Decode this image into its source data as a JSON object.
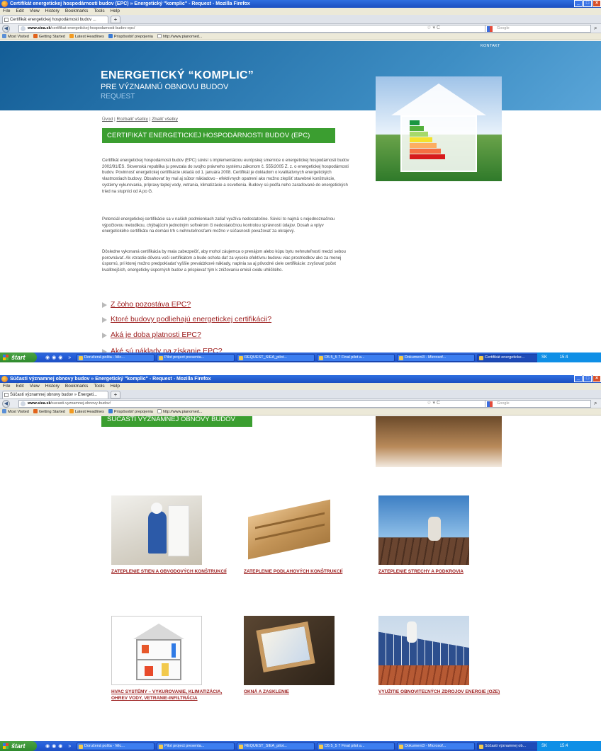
{
  "screen1": {
    "window_title": "Certifikát energetickej hospodárnosti budov (EPC) » Energetický \"komplic\" - Request - Mozilla Firefox",
    "menu": [
      "File",
      "Edit",
      "View",
      "History",
      "Bookmarks",
      "Tools",
      "Help"
    ],
    "tab_label": "Certifikát energetickej hospodárnosti budov ...",
    "url_domain": "www.siea.sk",
    "url_path": "/certifikat-energetickej-hospodarnosti-budov-epc/",
    "search_placeholder": "Google",
    "bookmarks": [
      "Most Visited",
      "Getting Started",
      "Latest Headlines",
      "Prispôsobiť prepojenia",
      "http://www.pianomed..."
    ],
    "page": {
      "kontakt": "KONTAKT",
      "brand_line1": "ENERGETICKÝ “KOMPLIC”",
      "brand_line2": "PRE VÝZNAMNÚ OBNOVU BUDOV",
      "brand_line3": "REQUEST",
      "crumb_uvod": "Úvod",
      "crumb_expand": "Rozbaliť všetky",
      "crumb_collapse": "Zbaliť všetky",
      "crumb_sep": " | ",
      "heading": "CERTIFIKÁT ENERGETICKEJ HOSPODÁRNOSTI BUDOV (EPC)",
      "paragraph1": "Certifikát energetickej hospodárnosti budov (EPC) súvisí s implementáciou európskej smernice o energetickej hospodárnosti budov 2002/91/ES. Slovenská republika ju prevzala do svojho právneho systému zákonom č. 555/2005 Z. z. o energetickej hospodárnosti budov. Povinnosť energetickej certifikácie ukladá od 1. januára 2008. Certifikát je dokladom o kvalitatívnych energetických vlastnostiach budovy. Obsahovať by mal aj súbor nákladovo - efektívnych opatrení ako možno zlepšiť stavebné konštrukcie, systémy vykurovania, prípravy teplej vody, vetrania, klimatizácie a osvetlenia. Budovy sú podľa neho zaraďované do energetických tried na stupnici od A po G.",
      "paragraph2": "Potenciál energetickej certifikácie sa v našich podmienkach zatiaľ využíva nedostatočne. Súvisí to najmä s nejednoznačnou výpočtovou metodikou, chýbajúcim jednotným softvérom či nedostatočnou kontrolou správnosti údajov. Dosah a vplyv energetického certifikátu na domáci trh s nehnuteľnosťami možno v súčasnosti považovať za okrajový.",
      "paragraph3": "Dôsledne vykonaná certifikácia by mala zabezpečiť, aby mohol záujemca o prenájom alebo kúpu bytu nehnuteľnosti medzi sebou porovnávať. Ak vzrastie dôvera voči certifikátom a bude ochota dať za vysoko efektívnu budovu viac prostriedkov ako za menej úspornú, pri ktorej možno predpokladať vyššie prevádzkové náklady, naplnia sa aj pôvodné ciele certifikácie: zvyšovať počet kvalitnejších, energeticky úsporných budov a prispievať tým k znižovaniu emisií oxidu uhličitého.",
      "faq": [
        "Z čoho pozostáva EPC?",
        "Ktoré budovy podliehajú energetickej certifikácii?",
        "Aká je doba platnosti EPC?",
        "Aké sú náklady na získanie EPC?"
      ],
      "energy_classes": [
        "A",
        "B",
        "C",
        "D",
        "E",
        "F",
        "G"
      ]
    },
    "taskbar": {
      "start": "štart",
      "buttons": [
        "Doručená pošta - Mic...",
        "Pilot project presenta...",
        "REQUEST_SIEA_pilot...",
        "D5 5_5 7 Final pilot a...",
        "Dokument3 - Microsof...",
        "Certifikát energeticke..."
      ],
      "tray_lang": "SK",
      "tray_time": "15:4"
    }
  },
  "screen2": {
    "window_title": "Súčasti významnej obnovy budov » Energetický \"komplic\" - Request - Mozilla Firefox",
    "menu": [
      "File",
      "Edit",
      "View",
      "History",
      "Bookmarks",
      "Tools",
      "Help"
    ],
    "tab_label": "Súčasti významnej obnovy budov » Energeti...",
    "url_domain": "www.siea.sk",
    "url_path": "/sucasti-vyznamnej-obnovy-budov/",
    "search_placeholder": "Google",
    "bookmarks": [
      "Most Visited",
      "Getting Started",
      "Latest Headlines",
      "Prispôsobiť prepojenia",
      "http://www.pianomed..."
    ],
    "page": {
      "heading": "SÚČASTI VÝZNAMNEJ OBNOVY BUDOV",
      "tiles": [
        "ZATEPLENIE STIEN A OBVODOVÝCH KONŠTRUKCIÍ",
        "ZATEPLENIE PODLAHOVÝCH KONŠTRUKCIÍ",
        "ZATEPLENIE STRECHY A PODKROVIA",
        "HVAC SYSTÉMY – VYKUROVANIE, KLIMATIZÁCIA, OHREV VODY, VETRANIE-INFILTRÁCIA",
        "OKNÁ A ZASKLENIE",
        "VYUŽITIE OBNOVITEĽNÝCH ZDROJOV ENERGIE (OZE)"
      ]
    },
    "taskbar": {
      "start": "štart",
      "buttons": [
        "Doručená pošta - Mic...",
        "Pilot project presenta...",
        "REQUEST_SIEA_pilot...",
        "D5 5_5 7 Final pilot a...",
        "Dokument3 - Microsof...",
        "Súčasti významnej ob..."
      ],
      "tray_lang": "SK",
      "tray_time": "15:4"
    }
  },
  "colors": {
    "green": "#3b9e30",
    "link_red": "#9b1b1b",
    "header_blue": "#1c6aa6"
  }
}
